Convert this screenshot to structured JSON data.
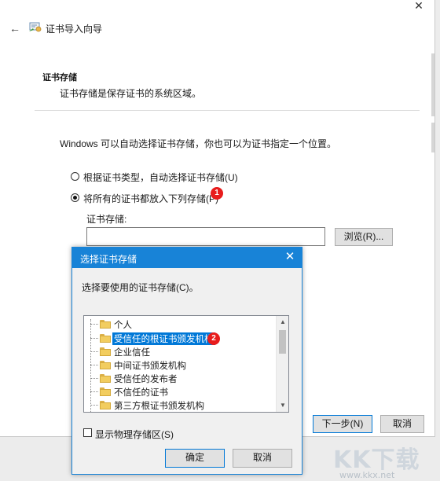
{
  "window": {
    "title": "证书导入向导",
    "close_glyph": "✕",
    "back_glyph": "←"
  },
  "section": {
    "title": "证书存储",
    "description": "证书存储是保存证书的系统区域。"
  },
  "info_text": "Windows 可以自动选择证书存储，你也可以为证书指定一个位置。",
  "options": [
    {
      "label": "根据证书类型，自动选择证书存储(U)",
      "checked": false
    },
    {
      "label": "将所有的证书都放入下列存储(P)",
      "checked": true
    }
  ],
  "store": {
    "label": "证书存储:",
    "value": "",
    "browse_label": "浏览(R)..."
  },
  "badges": {
    "one": "1",
    "two": "2"
  },
  "footer": {
    "next_label": "下一步(N)",
    "cancel_label": "取消"
  },
  "dialog": {
    "title": "选择证书存储",
    "close_glyph": "✕",
    "prompt": "选择要使用的证书存储(C)。",
    "tree_items": [
      {
        "label": "个人",
        "selected": false
      },
      {
        "label": "受信任的根证书颁发机构",
        "selected": true
      },
      {
        "label": "企业信任",
        "selected": false
      },
      {
        "label": "中间证书颁发机构",
        "selected": false
      },
      {
        "label": "受信任的发布者",
        "selected": false
      },
      {
        "label": "不信任的证书",
        "selected": false
      },
      {
        "label": "第三方根证书颁发机构",
        "selected": false
      }
    ],
    "show_physical_label": "显示物理存储区(S)",
    "show_physical_checked": false,
    "ok_label": "确定",
    "cancel_label": "取消"
  },
  "watermark": {
    "logo": "KK下载",
    "url": "www.kkx.net"
  },
  "colors": {
    "accent": "#0078d7",
    "titlebar": "#1883d7",
    "badge": "#e81c1c"
  }
}
